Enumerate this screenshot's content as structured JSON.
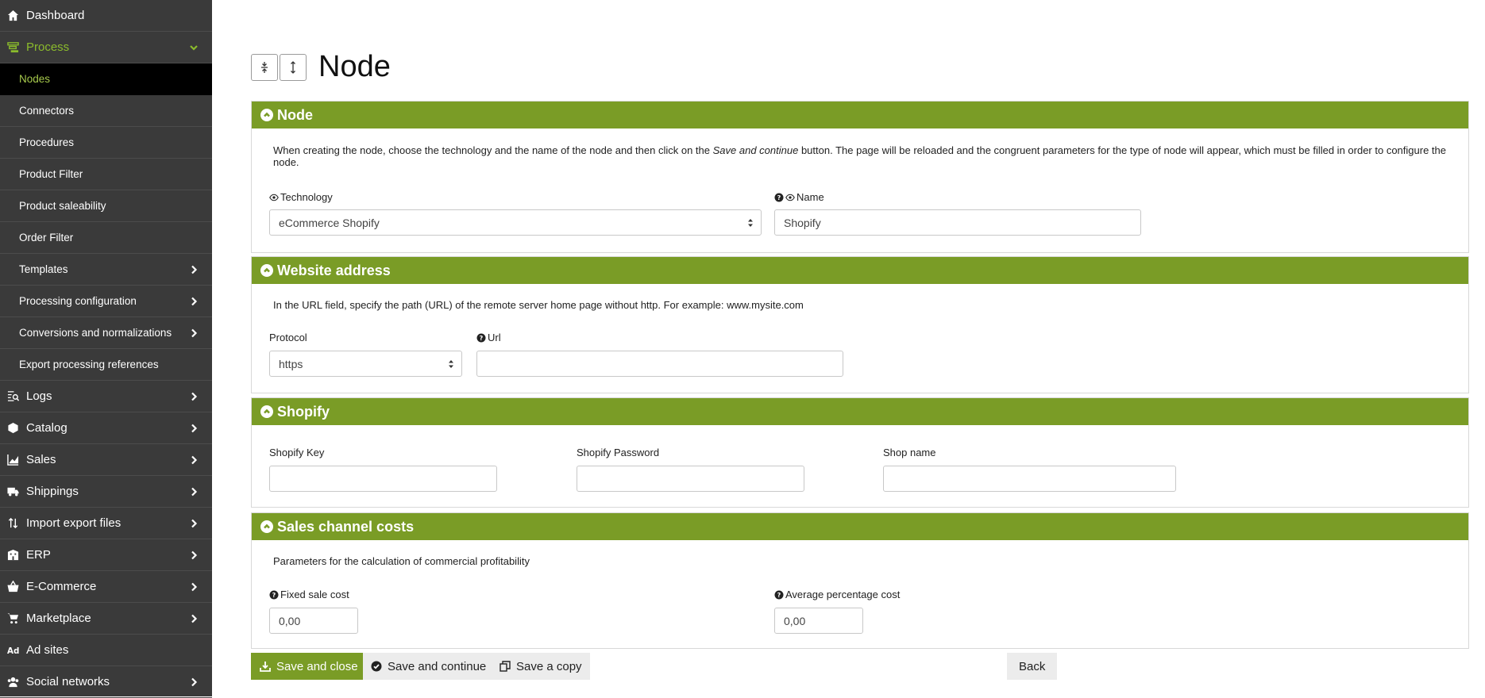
{
  "sidebar": {
    "items": [
      {
        "label": "Dashboard",
        "icon": "home-icon",
        "level": "top"
      },
      {
        "label": "Process",
        "icon": "process-icon",
        "level": "top",
        "expanded": true
      },
      {
        "label": "Nodes",
        "level": "sub",
        "active": true
      },
      {
        "label": "Connectors",
        "level": "sub"
      },
      {
        "label": "Procedures",
        "level": "sub"
      },
      {
        "label": "Product Filter",
        "level": "sub"
      },
      {
        "label": "Product saleability",
        "level": "sub"
      },
      {
        "label": "Order Filter",
        "level": "sub"
      },
      {
        "label": "Templates",
        "level": "sub",
        "chevron": true
      },
      {
        "label": "Processing configuration",
        "level": "sub",
        "chevron": true
      },
      {
        "label": "Conversions and normalizations",
        "level": "sub",
        "chevron": true
      },
      {
        "label": "Export processing references",
        "level": "sub"
      },
      {
        "label": "Logs",
        "icon": "logs-icon",
        "level": "top",
        "chevron": true
      },
      {
        "label": "Catalog",
        "icon": "cube-icon",
        "level": "top",
        "chevron": true
      },
      {
        "label": "Sales",
        "icon": "chart-icon",
        "level": "top",
        "chevron": true
      },
      {
        "label": "Shippings",
        "icon": "truck-icon",
        "level": "top",
        "chevron": true
      },
      {
        "label": "Import export files",
        "icon": "arrows-icon",
        "level": "top",
        "chevron": true
      },
      {
        "label": "ERP",
        "icon": "building-icon",
        "level": "top",
        "chevron": true
      },
      {
        "label": "E-Commerce",
        "icon": "basket-icon",
        "level": "top",
        "chevron": true
      },
      {
        "label": "Marketplace",
        "icon": "cart-icon",
        "level": "top",
        "chevron": true
      },
      {
        "label": "Ad sites",
        "icon": "ad-icon",
        "level": "top"
      },
      {
        "label": "Social networks",
        "icon": "users-icon",
        "level": "top",
        "chevron": true
      }
    ]
  },
  "page": {
    "title": "Node"
  },
  "node_panel": {
    "heading": "Node",
    "desc_before": "When creating the node, choose the technology and the name of the node and then click on the ",
    "desc_em": "Save and continue",
    "desc_after": " button. The page will be reloaded and the congruent parameters for the type of node will appear, which must be filled in order to configure the node.",
    "technology_label": "Technology",
    "technology_value": "eCommerce Shopify",
    "name_label": "Name",
    "name_value": "Shopify"
  },
  "website_panel": {
    "heading": "Website address",
    "desc": "In the URL field, specify the path (URL) of the remote server home page without http. For example: www.mysite.com",
    "protocol_label": "Protocol",
    "protocol_value": "https",
    "url_label": "Url",
    "url_value": ""
  },
  "shopify_panel": {
    "heading": "Shopify",
    "key_label": "Shopify Key",
    "password_label": "Shopify Password",
    "shop_label": "Shop name"
  },
  "costs_panel": {
    "heading": "Sales channel costs",
    "desc": "Parameters for the calculation of commercial profitability",
    "fixed_label": "Fixed sale cost",
    "fixed_value": "0,00",
    "avg_label": "Average percentage cost",
    "avg_value": "0,00"
  },
  "actions": {
    "save_close": "Save and close",
    "save_continue": "Save and continue",
    "save_copy": "Save a copy",
    "back": "Back"
  },
  "colors": {
    "accent": "#7a9c26",
    "sidebar": "#3a3a3a",
    "active_text": "#a6c94c"
  }
}
